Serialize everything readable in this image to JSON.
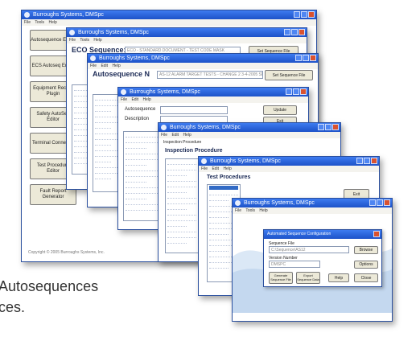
{
  "main_window": {
    "title": "Burroughs Systems, DMSpc",
    "menu": [
      "File",
      "Tools",
      "Help"
    ],
    "sidebar": [
      "Autosequence Editor",
      "ECS Autoseq Editor",
      "Equipment Record Plugin",
      "Safety AutoSeq Editor",
      "Terminal Connector",
      "Test Procedure Editor",
      "Fault Report Generator"
    ],
    "copyright": "Copyright © 2005 Burroughs Systems, Inc."
  },
  "window2": {
    "title": "Burroughs Systems, DMSpc",
    "menu": "File  Tools  Help",
    "heading": "ECO Sequence:",
    "field": "ECO - STANDARD DOCUMENT - TEST CODE MASK",
    "button": "Set Sequence File"
  },
  "window3": {
    "title": "Burroughs Systems, DMSpc",
    "menu": "File  Edit  Help",
    "heading": "Autosequence N",
    "field": "AS-12 ALARM TARGET TESTS - CHANGE 2 3-4-2005 SN",
    "button": "Set Sequence File"
  },
  "window4": {
    "title": "Burroughs Systems, DMSpc",
    "menu": "File  Edit  Help",
    "label1": "Autosequence",
    "label2": "Description",
    "button1": "Update",
    "button2": "Exit"
  },
  "window5": {
    "title": "Burroughs Systems, DMSpc",
    "menu": "File  Edit  Help",
    "label": "Inspection Procedure",
    "heading": "Inspection Procedure"
  },
  "window6": {
    "title": "Burroughs Systems, DMSpc",
    "menu": "File  Edit  Help",
    "heading": "Test Procedures",
    "button": "Exit"
  },
  "window7": {
    "title": "Burroughs Systems, DMSpc",
    "menu": "File  Tools  Help"
  },
  "dialog": {
    "title": "Automated Sequence Configuration",
    "label1": "Sequence File",
    "field1": "C:\\Sequence\\AS12",
    "button1": "Browse",
    "label2": "Version Number",
    "field2": "DMSPC",
    "button2": "Options",
    "buttons": [
      "Generate Sequence File",
      "Export Sequence Data",
      "Help",
      "Close"
    ]
  },
  "caption": {
    "line1": "Autosequences",
    "line2": "ces."
  },
  "colors": {
    "titlebar": "#1d52c8",
    "button_face": "#ece9d8",
    "close_button": "#d9522f",
    "wave": "#cfe0f3"
  }
}
